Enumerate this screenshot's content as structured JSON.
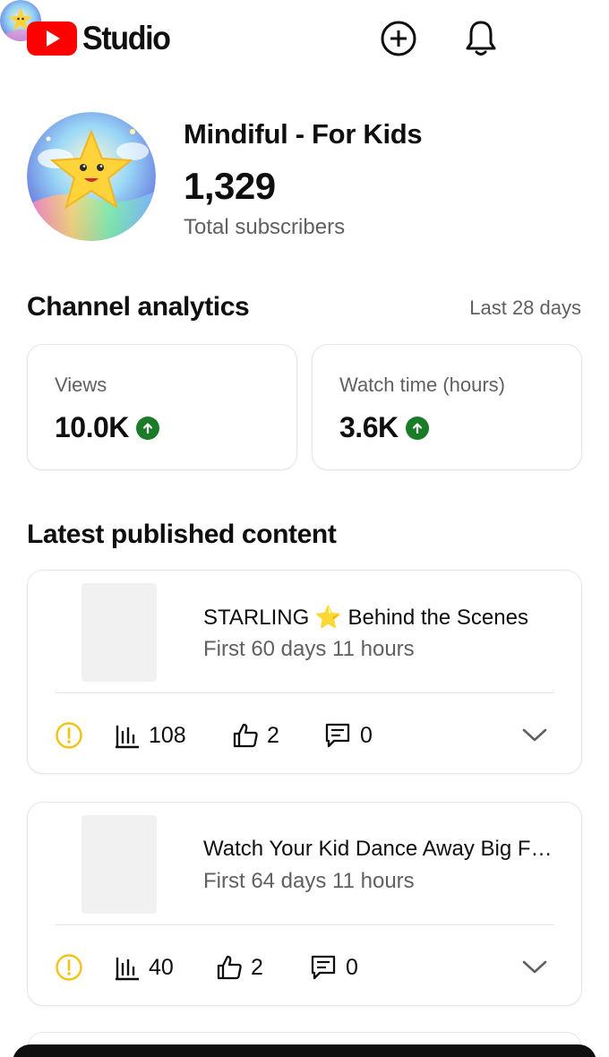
{
  "app": {
    "title": "Studio"
  },
  "header": {
    "icons": [
      "create-icon",
      "notifications-icon",
      "account-avatar"
    ]
  },
  "channel": {
    "name": "Mindiful - For Kids",
    "subscribers": "1,329",
    "subscribers_label": "Total subscribers"
  },
  "analytics": {
    "title": "Channel analytics",
    "period": "Last 28 days",
    "cards": [
      {
        "label": "Views",
        "value": "10.0K",
        "trend": "up"
      },
      {
        "label": "Watch time (hours)",
        "value": "3.6K",
        "trend": "up"
      }
    ]
  },
  "latest": {
    "title": "Latest published content",
    "items": [
      {
        "title": "STARLING ⭐ Behind the Scenes",
        "subtitle": "First 60 days 11 hours",
        "views": "108",
        "likes": "2",
        "comments": "0"
      },
      {
        "title": "Watch Your Kid Dance Away Big Feelings",
        "subtitle": "First 64 days 11 hours",
        "views": "40",
        "likes": "2",
        "comments": "0"
      }
    ]
  },
  "colors": {
    "brand_red": "#ff0000",
    "trend_up": "#1b7c27",
    "warning": "#f2c318",
    "secondary_text": "#606060"
  }
}
